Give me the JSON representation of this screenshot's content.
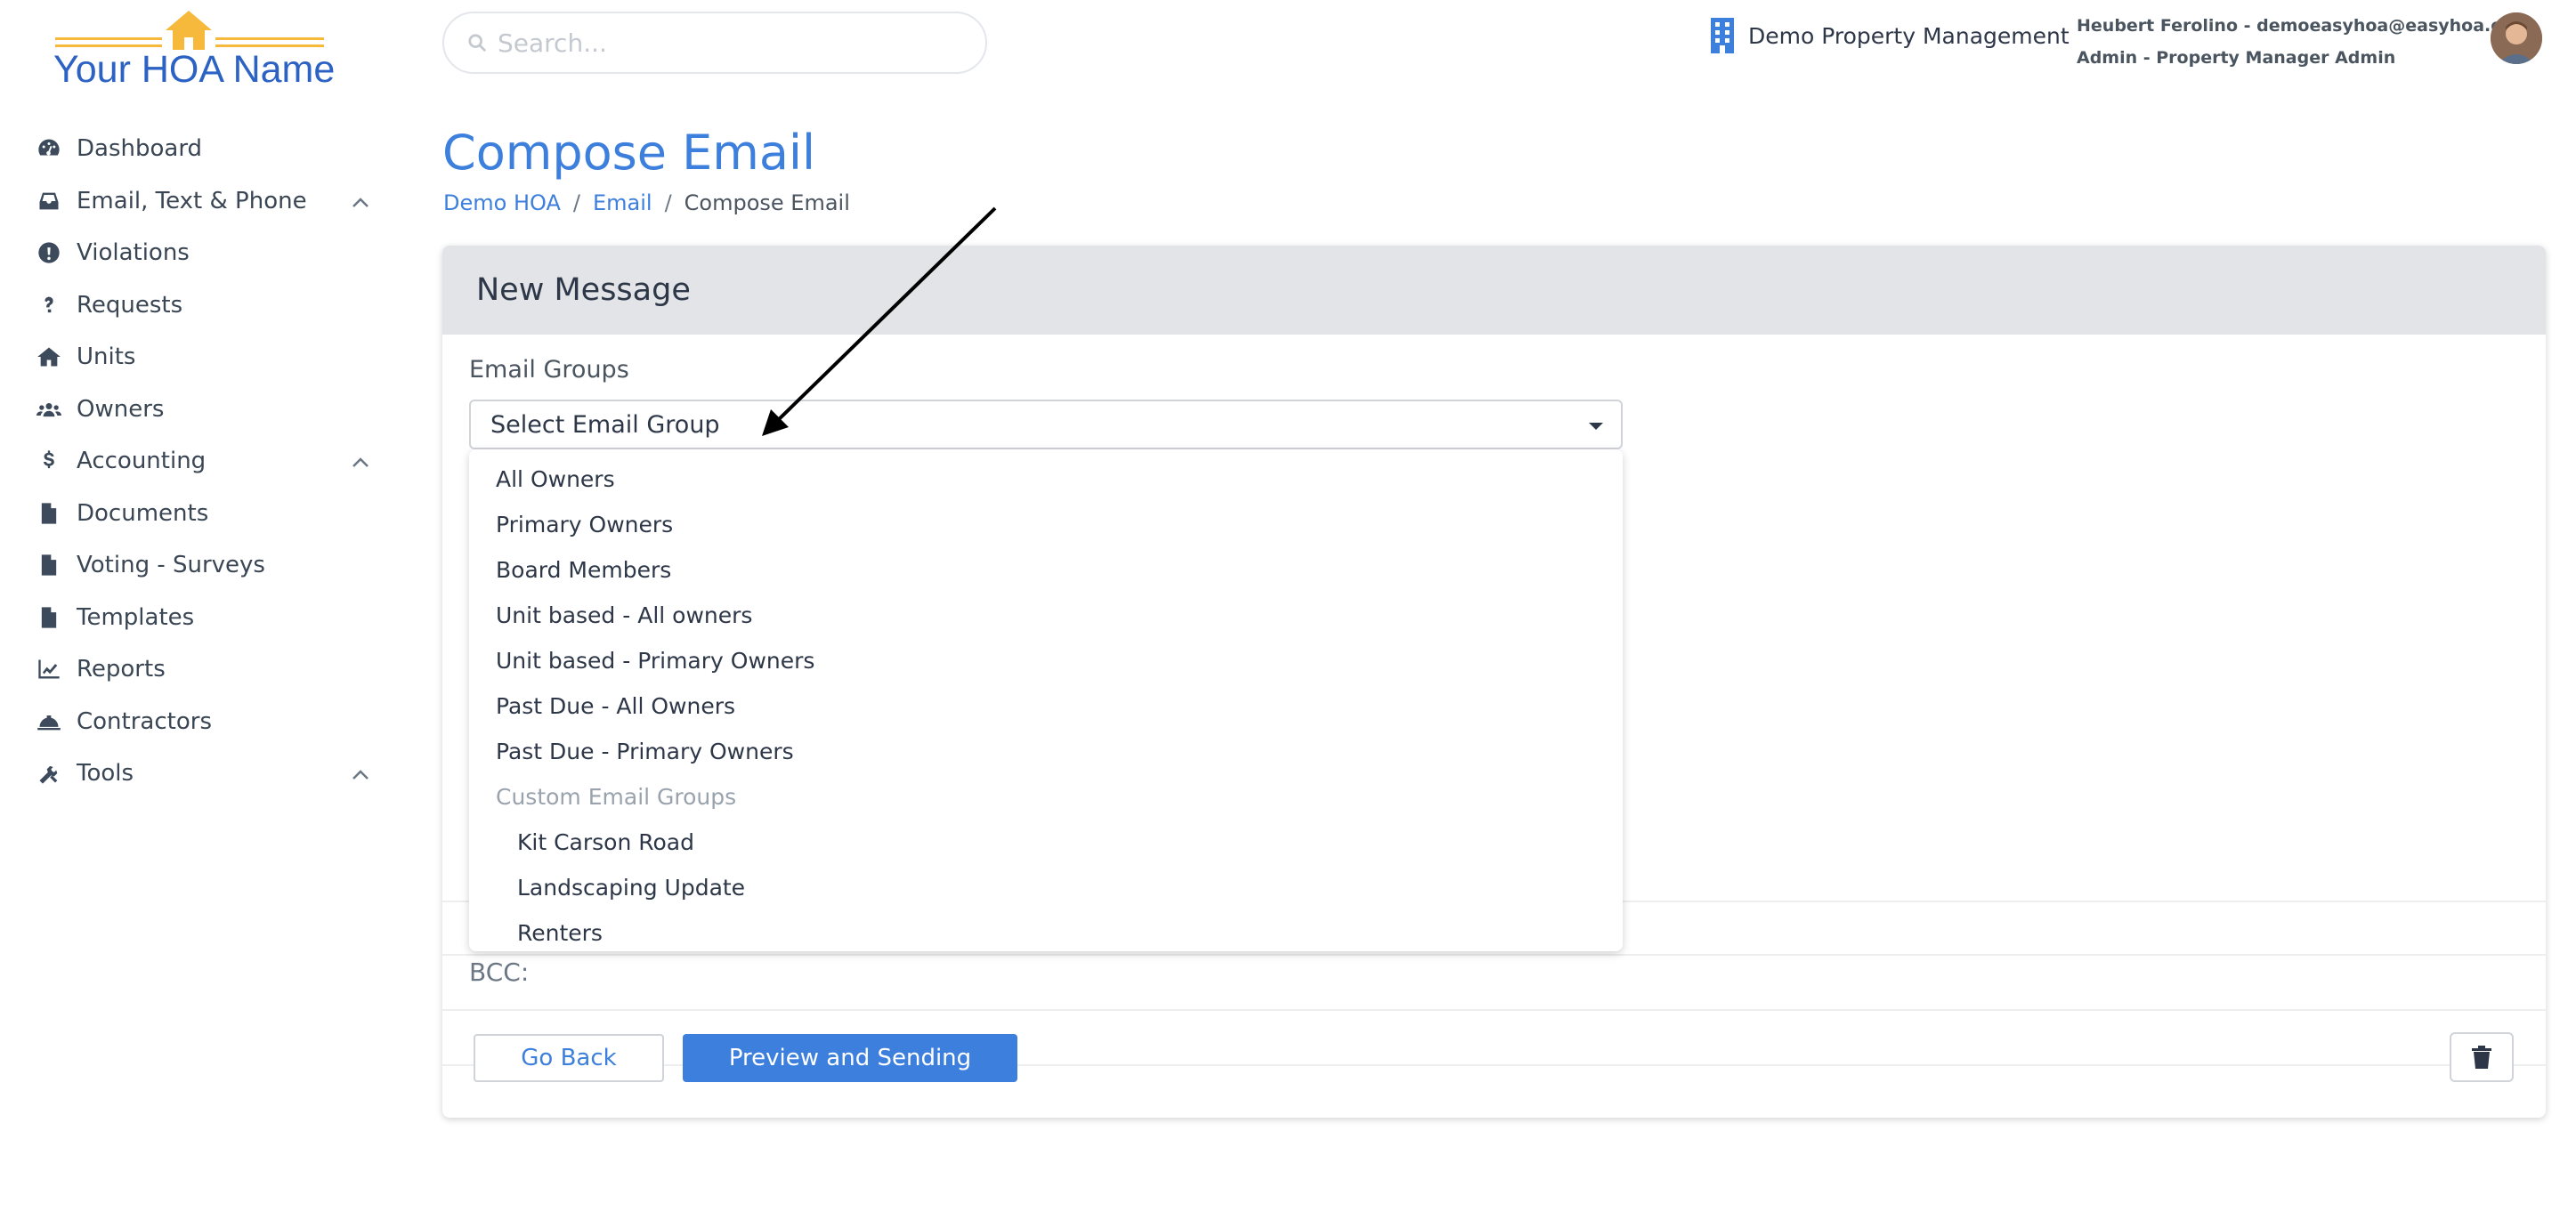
{
  "logo": {
    "name": "Your HOA Name"
  },
  "sidebar": {
    "items": [
      {
        "label": "Dashboard",
        "icon": "dashboard-icon",
        "expandable": false
      },
      {
        "label": "Email, Text & Phone",
        "icon": "inbox-icon",
        "expandable": true
      },
      {
        "label": "Violations",
        "icon": "exclamation-circle-icon",
        "expandable": false
      },
      {
        "label": "Requests",
        "icon": "question-icon",
        "expandable": false
      },
      {
        "label": "Units",
        "icon": "home-icon",
        "expandable": false
      },
      {
        "label": "Owners",
        "icon": "users-icon",
        "expandable": false
      },
      {
        "label": "Accounting",
        "icon": "dollar-icon",
        "expandable": true
      },
      {
        "label": "Documents",
        "icon": "file-icon",
        "expandable": false
      },
      {
        "label": "Voting - Surveys",
        "icon": "file-pdf-icon",
        "expandable": false
      },
      {
        "label": "Templates",
        "icon": "file-alt-icon",
        "expandable": false
      },
      {
        "label": "Reports",
        "icon": "chart-line-icon",
        "expandable": false
      },
      {
        "label": "Contractors",
        "icon": "hard-hat-icon",
        "expandable": false
      },
      {
        "label": "Tools",
        "icon": "tools-icon",
        "expandable": true
      }
    ]
  },
  "topbar": {
    "search_placeholder": "Search...",
    "company": "Demo Property Management",
    "user_line1": "Heubert Ferolino - demoeasyhoa@easyhoa.com",
    "user_line2": "Admin - Property Manager Admin"
  },
  "page": {
    "title": "Compose Email",
    "breadcrumb": [
      "Demo HOA",
      "Email",
      "Compose Email"
    ]
  },
  "card": {
    "header": "New Message",
    "email_groups_label": "Email Groups",
    "select_value": "Select Email Group",
    "bcc_label": "BCC:",
    "go_back": "Go Back",
    "preview": "Preview and Sending"
  },
  "dropdown": {
    "options": [
      {
        "label": "All Owners",
        "kind": "opt"
      },
      {
        "label": "Primary Owners",
        "kind": "opt"
      },
      {
        "label": "Board Members",
        "kind": "opt"
      },
      {
        "label": "Unit based - All owners",
        "kind": "opt"
      },
      {
        "label": "Unit based - Primary Owners",
        "kind": "opt"
      },
      {
        "label": "Past Due - All Owners",
        "kind": "opt"
      },
      {
        "label": "Past Due - Primary Owners",
        "kind": "opt"
      },
      {
        "label": "Custom Email Groups",
        "kind": "group"
      },
      {
        "label": "Kit Carson Road",
        "kind": "sub"
      },
      {
        "label": "Landscaping Update",
        "kind": "sub"
      },
      {
        "label": "Renters",
        "kind": "sub"
      }
    ]
  },
  "colors": {
    "accent": "#3d7fdc",
    "logo_yellow": "#f6b93b",
    "logo_blue": "#2b62c4",
    "card_header": "#e2e4e7"
  }
}
